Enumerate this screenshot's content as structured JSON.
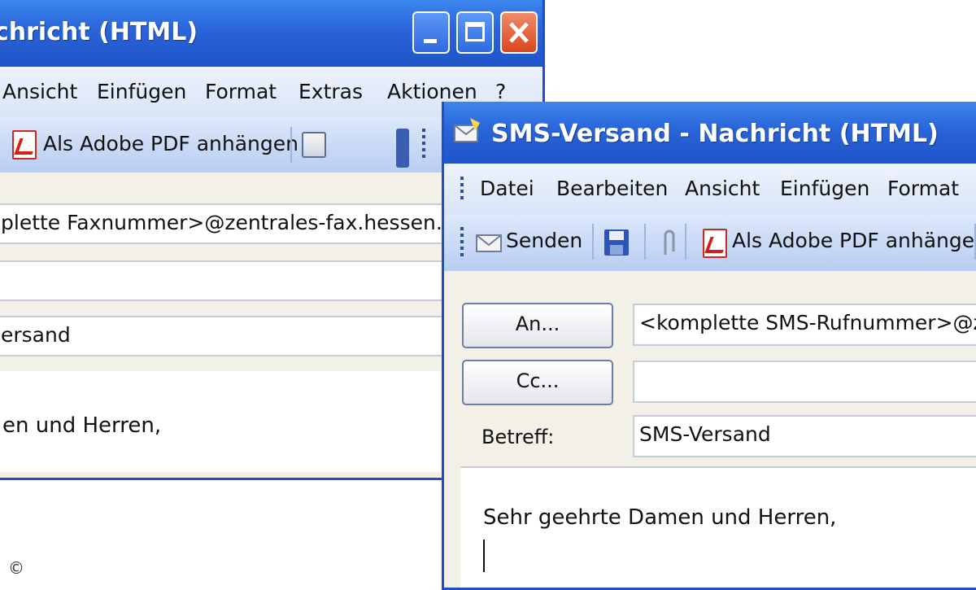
{
  "window1": {
    "title": "chricht (HTML)",
    "menu": [
      "Ansicht",
      "Einfügen",
      "Format",
      "Extras",
      "Aktionen",
      "?"
    ],
    "toolbar": {
      "pdf_label": "Als Adobe PDF anhängen"
    },
    "to_value": "plette Faxnummer>@zentrales-fax.hessen.de",
    "cc_value": "",
    "subject_value": "ersand",
    "body_text": "en und Herren,"
  },
  "window2": {
    "title": "SMS-Versand - Nachricht (HTML)",
    "menu": [
      "Datei",
      "Bearbeiten",
      "Ansicht",
      "Einfügen",
      "Format"
    ],
    "toolbar": {
      "send_label": "Senden",
      "pdf_label": "Als Adobe PDF anhängen"
    },
    "to_button": "An...",
    "cc_button": "Cc...",
    "subject_label": "Betreff:",
    "to_value": "<komplette SMS-Rufnummer>@zentra",
    "cc_value": "",
    "subject_value": "SMS-Versand",
    "body_text": "Sehr geehrte Damen und Herren,"
  },
  "copyright": "©",
  "colors": {
    "titlebar": "#2a64d8",
    "frame": "#1f4fc4",
    "close": "#d9461e",
    "pdf_red": "#d21f18"
  }
}
